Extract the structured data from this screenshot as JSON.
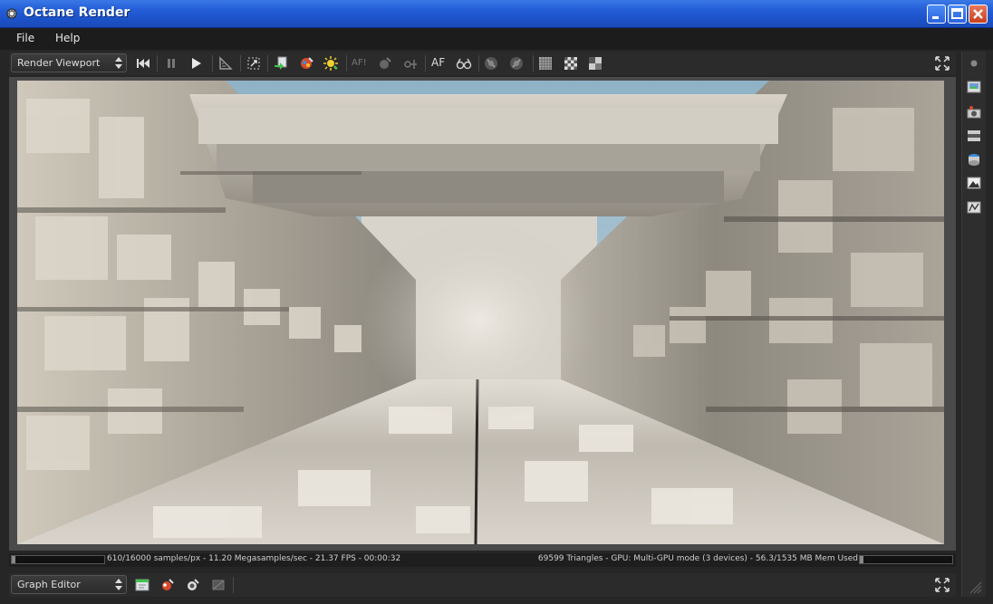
{
  "window": {
    "title": "Octane Render"
  },
  "menu": {
    "items": [
      "File",
      "Help"
    ]
  },
  "toolbar": {
    "viewport_select": "Render Viewport",
    "af_label": "AF",
    "afl_label": "AF!",
    "icons": [
      "skip-start-icon",
      "pause-icon",
      "play-icon",
      "ruler-icon",
      "region-icon",
      "export-icon",
      "color-pick-icon",
      "sun-icon",
      "af-pick-icon",
      "material-pick-icon",
      "focus-pick-icon",
      "stereo-glasses-icon",
      "lock-icon",
      "lock-alt-icon",
      "grid-icon",
      "checker-icon",
      "half-icon"
    ]
  },
  "status": {
    "left_text": "610/16000 samples/px - 11.20 Megasamples/sec - 21.37 FPS - 00:00:32",
    "right_text": "69599 Triangles - GPU: Multi-GPU mode (3 devices) - 56.3/1535 MB Mem Used",
    "render_progress": 0.038,
    "memory_progress": 0.037
  },
  "bottom": {
    "editor_select": "Graph Editor"
  },
  "colors": {
    "title_blue": "#245ed8",
    "panel": "#2b2b2b",
    "accent_icon": "#e8c23a"
  }
}
